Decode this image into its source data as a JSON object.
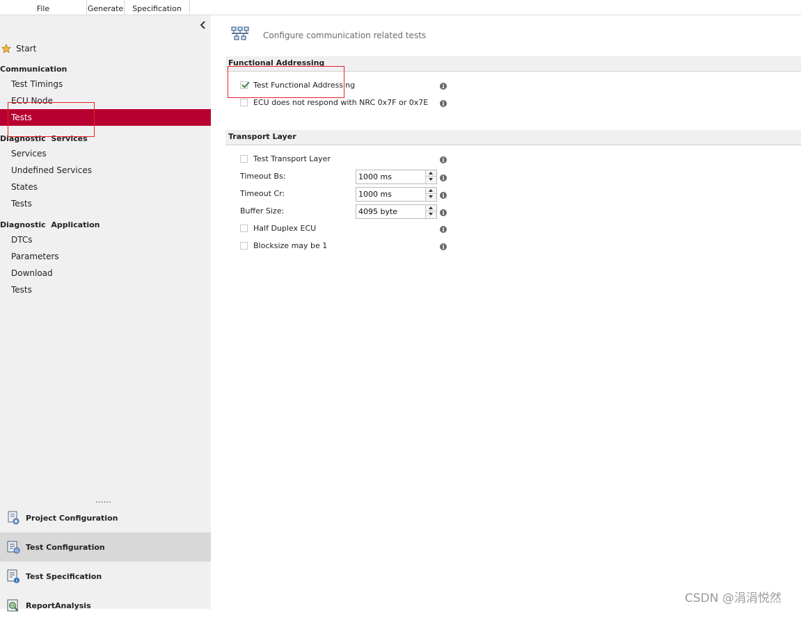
{
  "menu": {
    "file": "File",
    "generate": "Generate",
    "specification": "Specification"
  },
  "sidebar": {
    "start": "Start",
    "communication": {
      "title": "Communication",
      "items": [
        "Test Timings",
        "ECU Node",
        "Tests"
      ],
      "active_index": 2
    },
    "diagnostic_services": {
      "title": "Diagnostic  Services",
      "items": [
        "Services",
        "Undefined Services",
        "States",
        "Tests"
      ]
    },
    "diagnostic_application": {
      "title": "Diagnostic  Application",
      "items": [
        "DTCs",
        "Parameters",
        "Download",
        "Tests"
      ]
    },
    "dots": "......",
    "bottom": [
      "Project Configuration",
      "Test Configuration",
      "Test Specification",
      "ReportAnalysis"
    ],
    "bottom_selected": "Test Configuration"
  },
  "main": {
    "header": "Configure communication related tests",
    "functional": {
      "title": "Functional Addressing",
      "test_label": "Test Functional Addressing",
      "test_checked": true,
      "nrc_label": "ECU does not respond with NRC 0x7F or 0x7E",
      "nrc_checked": false
    },
    "transport": {
      "title": "Transport Layer",
      "test_label": "Test Transport Layer",
      "test_checked": false,
      "timeout_bs_label": "Timeout Bs:",
      "timeout_bs_value": "1000 ms",
      "timeout_cr_label": "Timeout Cr:",
      "timeout_cr_value": "1000 ms",
      "buffer_label": "Buffer Size:",
      "buffer_value": "4095 byte",
      "half_duplex_label": "Half Duplex ECU",
      "half_duplex_checked": false,
      "blocksize_label": "Blocksize may be 1",
      "blocksize_checked": false
    },
    "info_symbol": "i"
  },
  "colors": {
    "active_bg": "#b80030",
    "highlight": "#e8202a"
  },
  "watermark": "CSDN @涓涓悦然"
}
